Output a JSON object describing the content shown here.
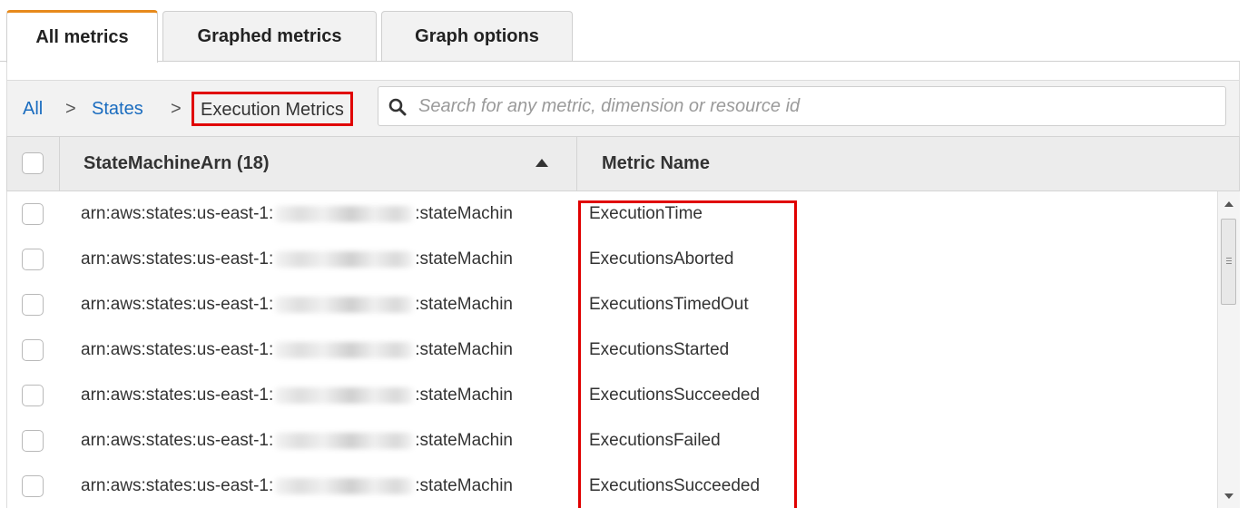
{
  "tabs": [
    {
      "label": "All metrics"
    },
    {
      "label": "Graphed metrics"
    },
    {
      "label": "Graph options"
    }
  ],
  "breadcrumb": {
    "items": [
      "All",
      "States",
      "Execution Metrics"
    ],
    "separator": ">"
  },
  "search": {
    "placeholder": "Search for any metric, dimension or resource id"
  },
  "table": {
    "columns": {
      "arn": "StateMachineArn (18)",
      "metric": "Metric Name"
    },
    "arn_prefix": "arn:aws:states:us-east-1:",
    "arn_suffix": ":stateMachin",
    "rows": [
      {
        "metric": "ExecutionTime"
      },
      {
        "metric": "ExecutionsAborted"
      },
      {
        "metric": "ExecutionsTimedOut"
      },
      {
        "metric": "ExecutionsStarted"
      },
      {
        "metric": "ExecutionsSucceeded"
      },
      {
        "metric": "ExecutionsFailed"
      },
      {
        "metric": "ExecutionsSucceeded"
      }
    ]
  },
  "colors": {
    "active_tab_accent": "#e78a1c",
    "link": "#1a6cbf",
    "highlight": "#e00000"
  },
  "icons": {
    "search": "search-icon",
    "sort": "sort-asc-icon"
  }
}
